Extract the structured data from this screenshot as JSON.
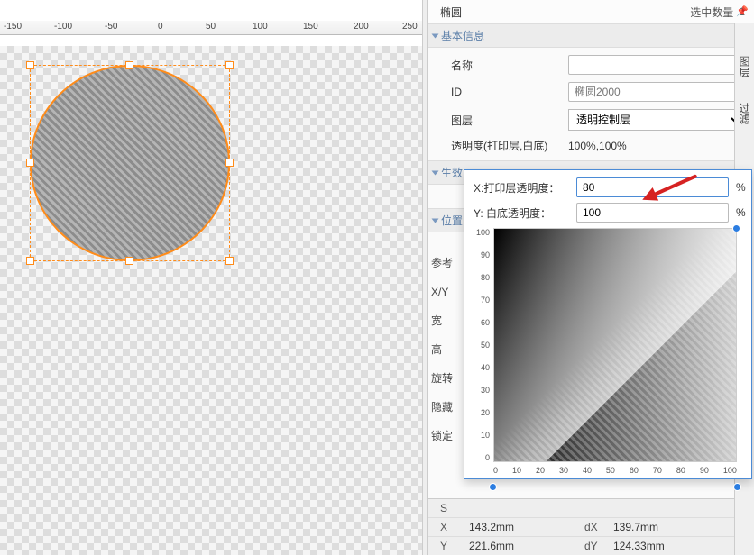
{
  "canvas": {
    "ruler_ticks": [
      "-150",
      "-100",
      "-50",
      "0",
      "50",
      "100",
      "150",
      "200",
      "250"
    ]
  },
  "header": {
    "object_type": "椭圆",
    "sel_label": "选中数量",
    "sel_count": "1"
  },
  "sections": {
    "basic": "基本信息",
    "effect_prefix": "生效",
    "pos_prefix": "位置"
  },
  "fields": {
    "name_label": "名称",
    "name_value": "",
    "id_label": "ID",
    "id_placeholder": "椭圆2000",
    "layer_label": "图层",
    "layer_value": "透明控制层",
    "opacity_label": "透明度(打印层,白底)",
    "opacity_value": "100%,100%"
  },
  "popup": {
    "x_label": "X:打印层透明度：",
    "x_value": "80",
    "y_label": "Y: 白底透明度：",
    "y_value": "100",
    "axis_ticks": [
      "0",
      "10",
      "20",
      "30",
      "40",
      "50",
      "60",
      "70",
      "80",
      "90",
      "100"
    ]
  },
  "left_side_labels": [
    "参考",
    "X/Y",
    "宽",
    "高",
    "旋转",
    "隐藏",
    "锁定"
  ],
  "status": {
    "S": "S",
    "X_key": "X",
    "X_val": "143.2mm",
    "dX_key": "dX",
    "dX_val": "139.7mm",
    "Y_key": "Y",
    "Y_val": "221.6mm",
    "dY_key": "dY",
    "dY_val": "124.33mm"
  },
  "tabs": {
    "layer": "图层",
    "filter": "过滤"
  },
  "chart_data": {
    "type": "heatmap",
    "title": "",
    "xlabel": "打印层透明度",
    "ylabel": "白底透明度",
    "xlim": [
      0,
      100
    ],
    "ylim": [
      0,
      100
    ],
    "markers": [
      {
        "x": 100,
        "y": 100
      },
      {
        "x": 0,
        "y": 0
      },
      {
        "x": 100,
        "y": 0
      }
    ],
    "note": "2D transparency picker; dark at low x, bright/striped at high x,y"
  }
}
